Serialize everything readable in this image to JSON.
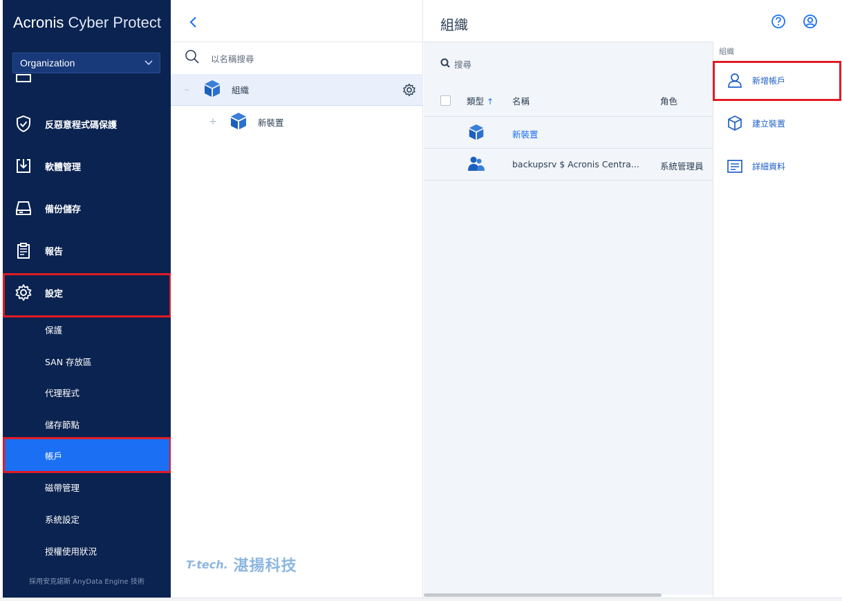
{
  "brand": {
    "bold": "Acronis",
    "light": "Cyber Protect"
  },
  "org_select": {
    "value": "Organization"
  },
  "nav": [
    {
      "label": "反惡意程式碼保護",
      "icon": "shield-check-icon"
    },
    {
      "label": "軟體管理",
      "icon": "download-box-icon"
    },
    {
      "label": "備份儲存",
      "icon": "storage-drive-icon"
    },
    {
      "label": "報告",
      "icon": "clipboard-report-icon"
    },
    {
      "label": "設定",
      "icon": "gear-icon"
    }
  ],
  "settings_sub": [
    {
      "label": "保護"
    },
    {
      "label": "SAN 存放區"
    },
    {
      "label": "代理程式"
    },
    {
      "label": "儲存節點"
    },
    {
      "label": "帳戶",
      "active": true
    },
    {
      "label": "磁帶管理"
    },
    {
      "label": "系統設定"
    },
    {
      "label": "授權使用狀況"
    }
  ],
  "footer": "採用安克諾斯 AnyData Engine 技術",
  "tree": {
    "search_placeholder": "以名稱搜尋",
    "nodes": [
      {
        "label": "組織",
        "toggle": "–",
        "selected": true
      },
      {
        "label": "新裝置",
        "toggle": "+"
      }
    ]
  },
  "watermark": {
    "logo": "T-tech.",
    "text": "湛揚科技"
  },
  "main": {
    "title": "組織",
    "search_placeholder": "搜尋",
    "columns": {
      "type": "類型",
      "name": "名稱",
      "role": "角色"
    },
    "sort_indicator": "↑",
    "rows": [
      {
        "type_icon": "cube-icon",
        "name": "新裝置",
        "role": ""
      },
      {
        "type_icon": "users-icon",
        "name": "backupsrv $ Acronis Centra...",
        "role": "系統管理員"
      }
    ]
  },
  "actions": {
    "title": "組織",
    "items": [
      {
        "label": "新增帳戶",
        "icon": "user-add-icon"
      },
      {
        "label": "建立裝置",
        "icon": "cube-outline-icon"
      },
      {
        "label": "詳細資料",
        "icon": "details-list-icon"
      }
    ]
  },
  "colors": {
    "sidebar": "#0b2350",
    "accent": "#1b6ff2",
    "highlight": "#e11b25"
  }
}
